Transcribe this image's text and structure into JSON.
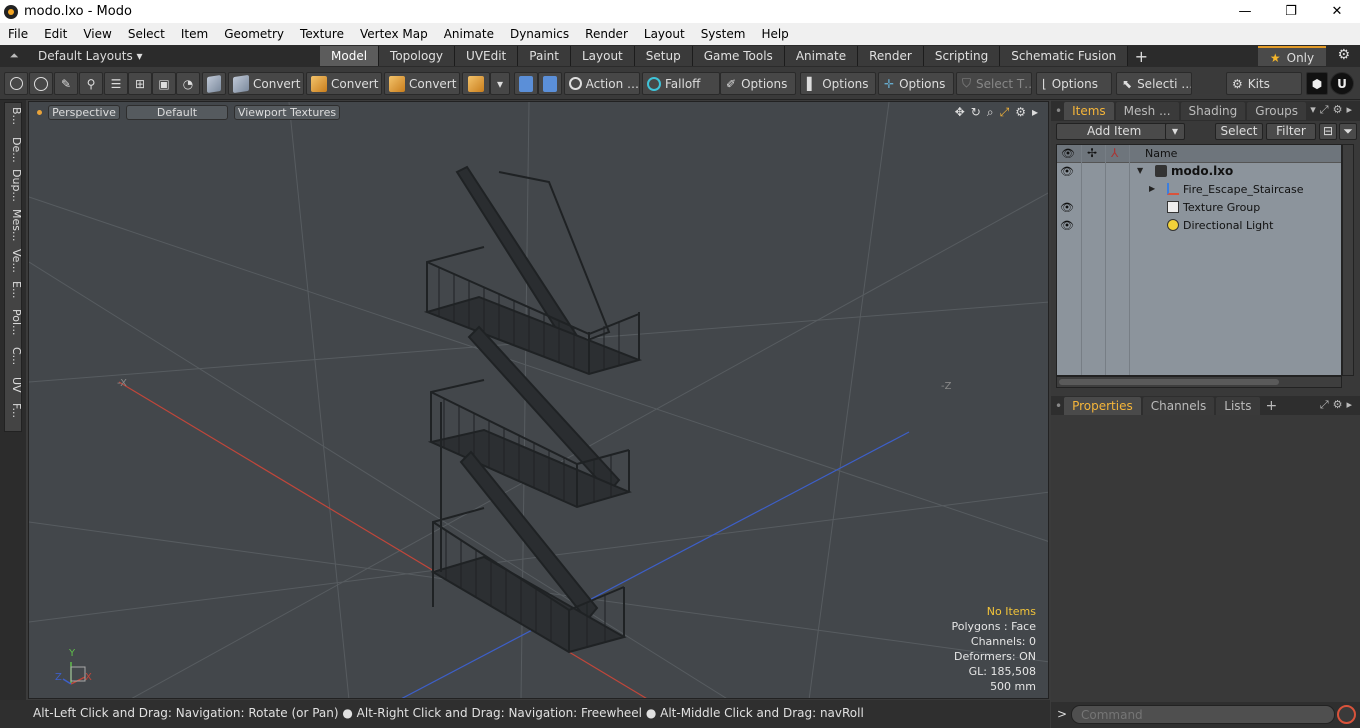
{
  "window": {
    "title": "modo.lxo - Modo",
    "controls": [
      "—",
      "❐",
      "✕"
    ]
  },
  "menu": [
    "File",
    "Edit",
    "View",
    "Select",
    "Item",
    "Geometry",
    "Texture",
    "Vertex Map",
    "Animate",
    "Dynamics",
    "Render",
    "Layout",
    "System",
    "Help"
  ],
  "layoutbar": {
    "layouts_label": "Default Layouts ▾",
    "tabs": [
      "Model",
      "Topology",
      "UVEdit",
      "Paint",
      "Layout",
      "Setup",
      "Game Tools",
      "Animate",
      "Render",
      "Scripting",
      "Schematic Fusion"
    ],
    "active_tab": "Model",
    "only_label": "Only"
  },
  "toolbar": {
    "convert1": "Convert",
    "convert2": "Convert",
    "convert3": "Convert",
    "action": "Action …",
    "falloff": "Falloff",
    "options1": "Options",
    "options2": "Options",
    "options3": "Options",
    "select_t": "Select T…",
    "options4": "Options",
    "selecti": "Selecti …",
    "kits": "Kits"
  },
  "left_tabs": [
    "B...",
    "De...",
    "Dup...",
    "Mes...",
    "Ve...",
    "E...",
    "Pol...",
    "C...",
    "UV",
    "F..."
  ],
  "viewport": {
    "view_label": "Perspective",
    "style_label": "Default",
    "texture_label": "Viewport Textures",
    "stats": {
      "selection": "No Items",
      "polygons": "Polygons : Face",
      "channels": "Channels: 0",
      "deformers": "Deformers: ON",
      "gl": "GL: 185,508",
      "unit": "500 mm"
    },
    "axis_labels": {
      "neg_x": "-X",
      "neg_z": "-Z",
      "y": "Y",
      "x": "X",
      "z": "Z"
    }
  },
  "statusbar": {
    "hint": "Alt-Left Click and Drag: Navigation: Rotate (or Pan) ● Alt-Right Click and Drag: Navigation: Freewheel ● Alt-Middle Click and Drag: navRoll"
  },
  "items_panel": {
    "tabs": [
      "Items",
      "Mesh ...",
      "Shading",
      "Groups"
    ],
    "active_tab": "Items",
    "add_item": "Add Item",
    "select": "Select",
    "filter": "Filter",
    "column_name": "Name",
    "rows": [
      {
        "label": "modo.lxo",
        "bold": true,
        "eye": true
      },
      {
        "label": "Fire_Escape_Staircase",
        "bold": false,
        "eye": false
      },
      {
        "label": "Texture Group",
        "bold": false,
        "eye": true
      },
      {
        "label": "Directional Light",
        "bold": false,
        "eye": true
      }
    ]
  },
  "properties_panel": {
    "tabs": [
      "Properties",
      "Channels",
      "Lists"
    ],
    "active_tab": "Properties"
  },
  "command": {
    "prompt": ">",
    "placeholder": "Command"
  },
  "colors": {
    "accent": "#f5b53a",
    "viewport_bg": "#43474b",
    "grid_line": "#575c60",
    "axis_x": "#c0463a",
    "axis_z": "#3d5fc8",
    "staircase": "#1f2224"
  }
}
